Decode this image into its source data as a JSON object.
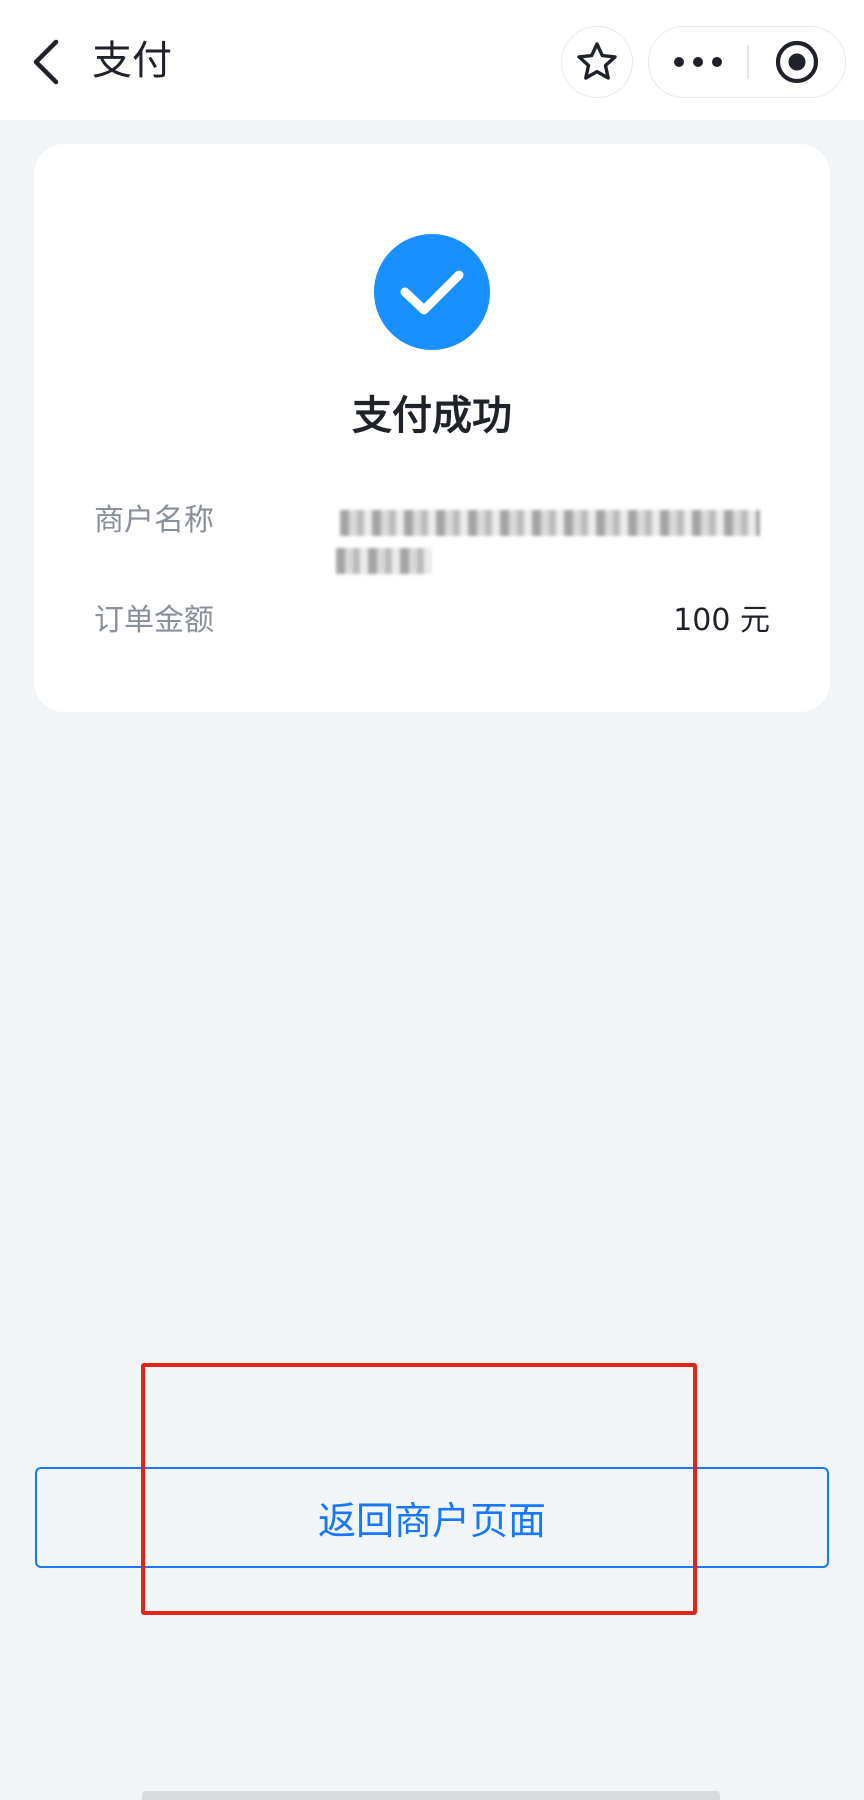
{
  "header": {
    "title": "支付",
    "back_icon": "chevron-left-icon",
    "favorite_icon": "star-outline-icon",
    "more_icon": "more-horizontal-icon",
    "close_icon": "target-circle-icon"
  },
  "result": {
    "icon": "check-circle-icon",
    "status_color": "#1890ff",
    "title": "支付成功"
  },
  "details": {
    "merchant_label": "商户名称",
    "merchant_value_obscured": true,
    "amount_label": "订单金额",
    "amount_value": "100 元"
  },
  "actions": {
    "return_label": "返回商户页面",
    "accent_color": "#1677ff"
  },
  "annotation": {
    "highlight_color": "#e2231a"
  }
}
